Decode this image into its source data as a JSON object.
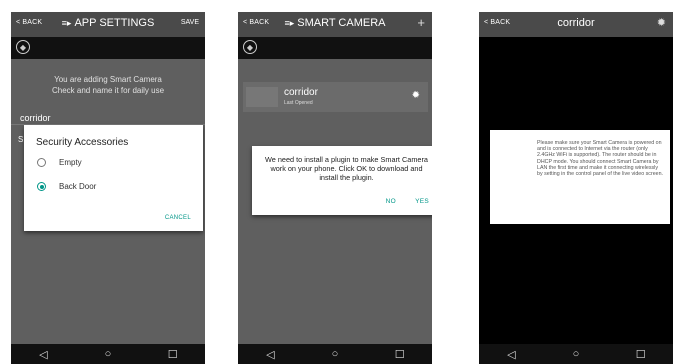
{
  "phone1": {
    "back": "< BACK",
    "title": "APP SETTINGS",
    "save": "SAVE",
    "message_line1": "You are adding Smart Camera",
    "message_line2": "Check and name it for daily use",
    "name": "corridor",
    "dialog_title": "Security Accessories",
    "options": [
      "Empty",
      "Back Door"
    ],
    "selected_option": "Back Door",
    "cancel": "CANCEL"
  },
  "phone2": {
    "back": "< BACK",
    "title": "SMART CAMERA",
    "plus": "+",
    "camera_name": "corridor",
    "camera_sub": "Last Opened",
    "dialog_text": "We need to install a plugin to make Smart Camera work on your phone. Click OK to download and install the plugin.",
    "no": "NO",
    "yes": "YES"
  },
  "phone3": {
    "back": "< BACK",
    "title": "corridor",
    "dialog_text": "Please make sure your Smart Camera is powered on and is connected to Internet via the router (only 2.4GHz WiFi is supported). The router should be in DHCP mode. You should connect Smart Camera by LAN the first time and make it connecting wirelessly by setting in the control panel of the live video screen."
  },
  "nav": {
    "back_icon": "◁",
    "home_icon": "○",
    "recent_icon": "☐"
  },
  "colors": {
    "accent": "#009688",
    "topbar": "#4a4a4a",
    "overlay": "#5f5f5f"
  }
}
